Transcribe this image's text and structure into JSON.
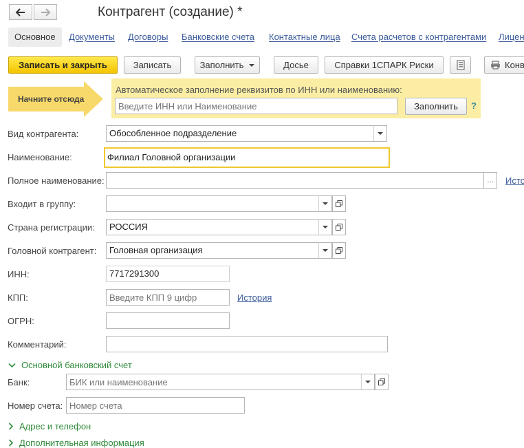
{
  "window": {
    "title": "Контрагент (создание) *"
  },
  "tabs": [
    {
      "label": "Основное"
    },
    {
      "label": "Документы"
    },
    {
      "label": "Договоры"
    },
    {
      "label": "Банковские счета"
    },
    {
      "label": "Контактные лица"
    },
    {
      "label": "Счета расчетов с контрагентами"
    },
    {
      "label": "Лицен"
    }
  ],
  "toolbar": {
    "save_close": "Записать и закрыть",
    "save": "Записать",
    "fill": "Заполнить",
    "dossier": "Досье",
    "spark": "Справки 1СПАРК Риски",
    "convert": "Конв"
  },
  "start": {
    "arrow_label": "Начните отсюда",
    "info_text": "Автоматическое заполнение реквизитов по ИНН или наименованию:",
    "search_placeholder": "Введите ИНН или Наименование",
    "fill_button": "Заполнить",
    "help": "?"
  },
  "form": {
    "kind": {
      "label": "Вид контрагента:",
      "value": "Обособленное подразделение"
    },
    "name": {
      "label": "Наименование:",
      "value": "Филиал Головной организации"
    },
    "full_name": {
      "label": "Полное наименование:",
      "value": "",
      "ellipsis": "...",
      "history": "Исто"
    },
    "group": {
      "label": "Входит в группу:",
      "value": ""
    },
    "country": {
      "label": "Страна регистрации:",
      "value": "РОССИЯ"
    },
    "head": {
      "label": "Головной контрагент:",
      "value": "Головная организация"
    },
    "inn": {
      "label": "ИНН:",
      "value": "7717291300"
    },
    "kpp": {
      "label": "КПП:",
      "placeholder": "Введите КПП 9 цифр",
      "history": "История"
    },
    "ogrn": {
      "label": "ОГРН:",
      "value": ""
    },
    "comment": {
      "label": "Комментарий:",
      "value": ""
    }
  },
  "bank_section": {
    "title": "Основной банковский счет",
    "bank_label": "Банк:",
    "bank_placeholder": "БИК или наименование",
    "account_label": "Номер счета:",
    "account_placeholder": "Номер счета"
  },
  "sections": {
    "address": "Адрес и телефон",
    "additional": "Дополнительная информация"
  },
  "colors": {
    "accent_yellow": "#f4c400",
    "link_blue": "#3b5b9b",
    "section_green": "#2f8a3a",
    "info_bg": "#fbeea4"
  }
}
